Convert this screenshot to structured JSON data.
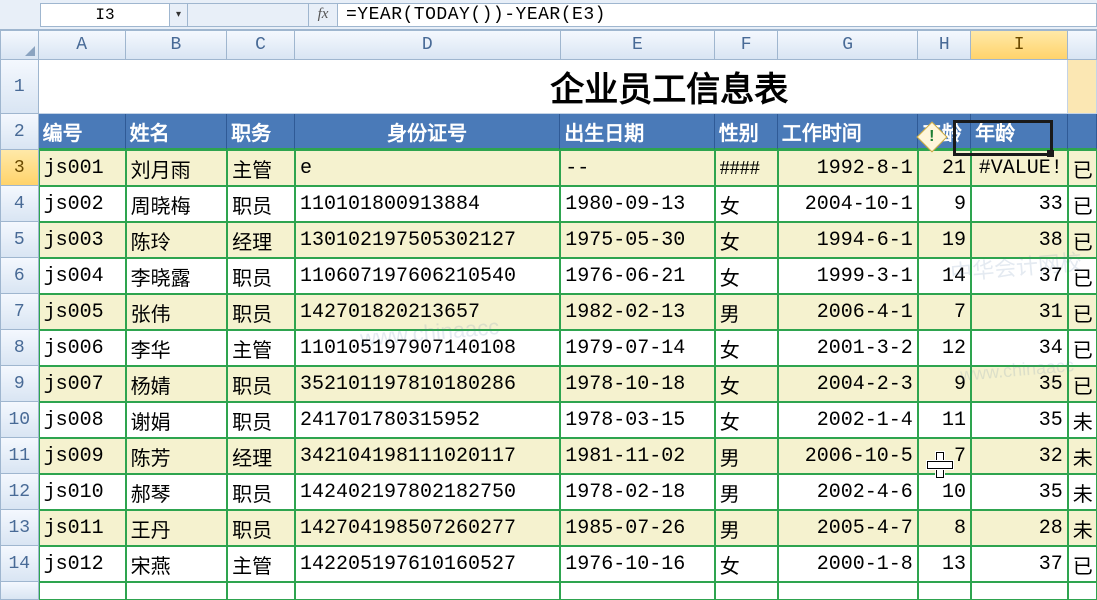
{
  "formula_bar": {
    "name_box": "I3",
    "fx_label": "fx",
    "formula": "=YEAR(TODAY())-YEAR(E3)"
  },
  "columns": [
    "A",
    "B",
    "C",
    "D",
    "E",
    "F",
    "G",
    "H",
    "I"
  ],
  "selected_column": "I",
  "selected_row": 3,
  "title": "企业员工信息表",
  "headers": {
    "A": "编号",
    "B": "姓名",
    "C": "职务",
    "D": "身份证号",
    "E": "出生日期",
    "F": "性别",
    "G": "工作时间",
    "H": "工龄",
    "I": "年龄"
  },
  "rows": [
    {
      "n": 3,
      "A": "js001",
      "B": "刘月雨",
      "C": "主管",
      "D": "e",
      "E": "--",
      "F": "####",
      "G": "1992-8-1",
      "H": "21",
      "I": "#VALUE!",
      "J": "已"
    },
    {
      "n": 4,
      "A": "js002",
      "B": "周晓梅",
      "C": "职员",
      "D": "110101800913884",
      "E": "1980-09-13",
      "F": "女",
      "G": "2004-10-1",
      "H": "9",
      "I": "33",
      "J": "已"
    },
    {
      "n": 5,
      "A": "js003",
      "B": "陈玲",
      "C": "经理",
      "D": "130102197505302127",
      "E": "1975-05-30",
      "F": "女",
      "G": "1994-6-1",
      "H": "19",
      "I": "38",
      "J": "已"
    },
    {
      "n": 6,
      "A": "js004",
      "B": "李晓露",
      "C": "职员",
      "D": "110607197606210540",
      "E": "1976-06-21",
      "F": "女",
      "G": "1999-3-1",
      "H": "14",
      "I": "37",
      "J": "已"
    },
    {
      "n": 7,
      "A": "js005",
      "B": "张伟",
      "C": "职员",
      "D": "142701820213657",
      "E": "1982-02-13",
      "F": "男",
      "G": "2006-4-1",
      "H": "7",
      "I": "31",
      "J": "已"
    },
    {
      "n": 8,
      "A": "js006",
      "B": "李华",
      "C": "主管",
      "D": "110105197907140108",
      "E": "1979-07-14",
      "F": "女",
      "G": "2001-3-2",
      "H": "12",
      "I": "34",
      "J": "已"
    },
    {
      "n": 9,
      "A": "js007",
      "B": "杨婧",
      "C": "职员",
      "D": "352101197810180286",
      "E": "1978-10-18",
      "F": "女",
      "G": "2004-2-3",
      "H": "9",
      "I": "35",
      "J": "已"
    },
    {
      "n": 10,
      "A": "js008",
      "B": "谢娟",
      "C": "职员",
      "D": "241701780315952",
      "E": "1978-03-15",
      "F": "女",
      "G": "2002-1-4",
      "H": "11",
      "I": "35",
      "J": "未"
    },
    {
      "n": 11,
      "A": "js009",
      "B": "陈芳",
      "C": "经理",
      "D": "342104198111020117",
      "E": "1981-11-02",
      "F": "男",
      "G": "2006-10-5",
      "H": "7",
      "I": "32",
      "J": "未"
    },
    {
      "n": 12,
      "A": "js010",
      "B": "郝琴",
      "C": "职员",
      "D": "142402197802182750",
      "E": "1978-02-18",
      "F": "男",
      "G": "2002-4-6",
      "H": "10",
      "I": "35",
      "J": "未"
    },
    {
      "n": 13,
      "A": "js011",
      "B": "王丹",
      "C": "职员",
      "D": "142704198507260277",
      "E": "1985-07-26",
      "F": "男",
      "G": "2005-4-7",
      "H": "8",
      "I": "28",
      "J": "未"
    },
    {
      "n": 14,
      "A": "js012",
      "B": "宋燕",
      "C": "主管",
      "D": "142205197610160527",
      "E": "1976-10-16",
      "F": "女",
      "G": "2000-1-8",
      "H": "13",
      "I": "37",
      "J": "已"
    }
  ],
  "error_icon": "!",
  "watermarks": [
    "www.chinaacc",
    "中华会计网校",
    "会计"
  ]
}
